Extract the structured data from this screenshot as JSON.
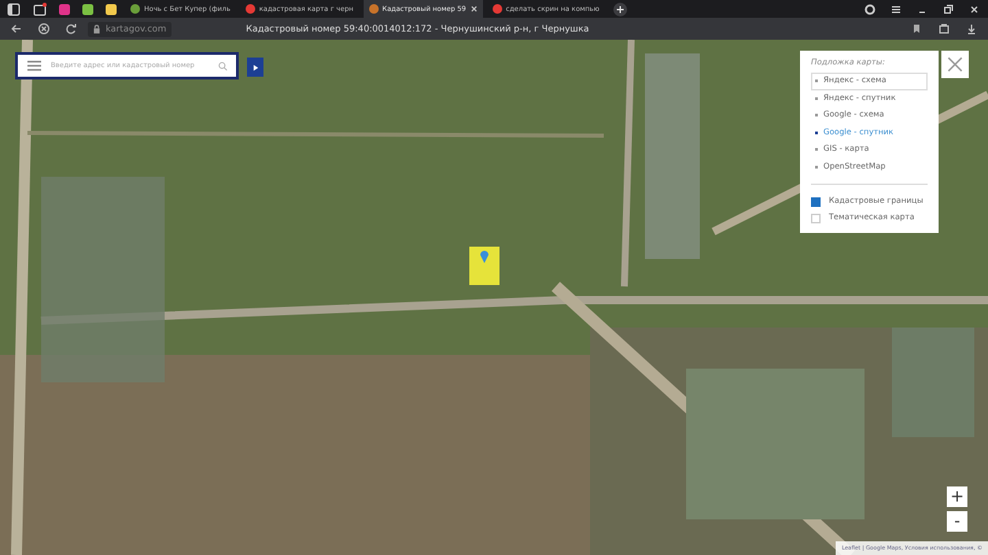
{
  "browser": {
    "tabs": [
      {
        "kind": "pinned",
        "selected": false,
        "color": "#e0338a"
      },
      {
        "kind": "pinned",
        "selected": false,
        "color": "#7bc043"
      },
      {
        "kind": "pinned",
        "selected": false,
        "color": "#f2c94c"
      },
      {
        "kind": "page",
        "label": "Ночь с Бет Купер (филь",
        "selected": false,
        "color": "#6a9e3a"
      },
      {
        "kind": "page",
        "label": "кадастровая карта г черн",
        "selected": false,
        "color": "#e53935"
      },
      {
        "kind": "page",
        "label": "Кадастровый номер 59",
        "selected": true,
        "color": "#c8732a"
      },
      {
        "kind": "page",
        "label": "сделать скрин на компью",
        "selected": false,
        "color": "#e53935"
      }
    ],
    "url": "kartagov.com",
    "page_title": "Кадастровый номер 59:40:0014012:172 - Чернушинский р-н, г Чернушка"
  },
  "search": {
    "placeholder": "Введите адрес или кадастровый номер"
  },
  "layers": {
    "title": "Подложка карты:",
    "items": [
      {
        "label": "Яндекс - схема",
        "selected": false,
        "hovered": true
      },
      {
        "label": "Яндекс - спутник",
        "selected": false,
        "hovered": false
      },
      {
        "label": "Google - схема",
        "selected": false,
        "hovered": false
      },
      {
        "label": "Google - спутник",
        "selected": true,
        "hovered": false
      },
      {
        "label": "GIS - карта",
        "selected": false,
        "hovered": false
      },
      {
        "label": "OpenStreetMap",
        "selected": false,
        "hovered": false
      }
    ],
    "overlays": [
      {
        "label": "Кадастровые границы",
        "checked": true
      },
      {
        "label": "Тематическая карта",
        "checked": false
      }
    ]
  },
  "zoom": {
    "in": "+",
    "out": "-"
  },
  "attribution": "Leaflet | Google Maps, Условия использования, ©"
}
